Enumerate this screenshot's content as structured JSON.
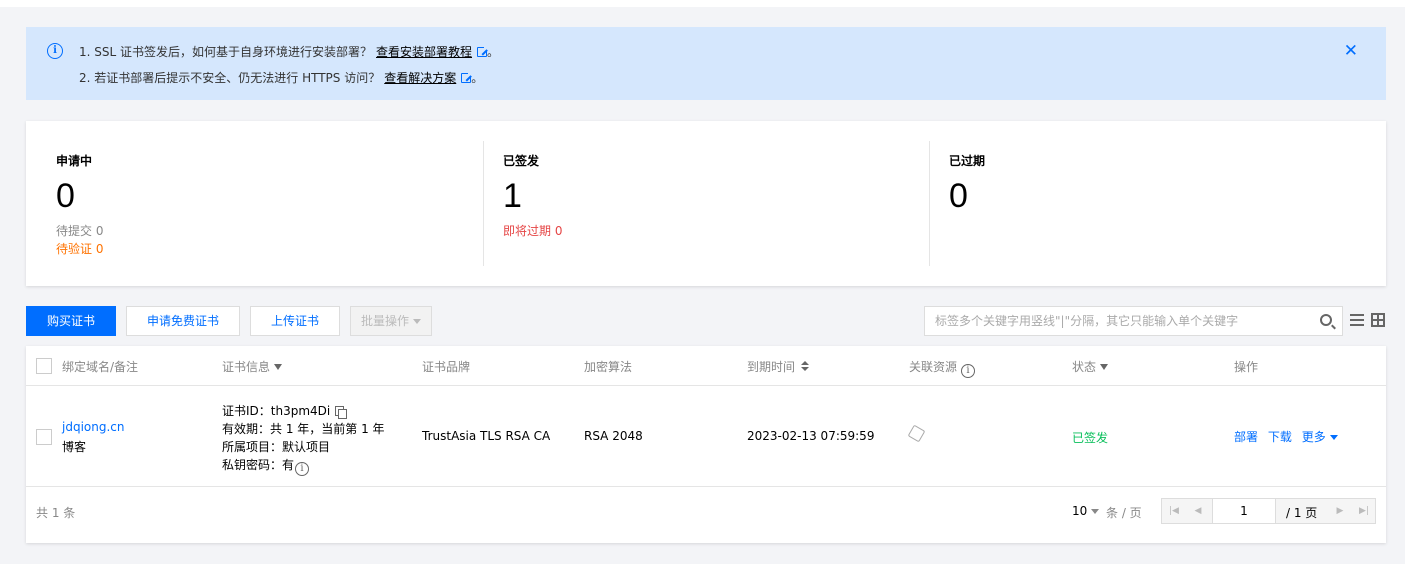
{
  "notice": {
    "line1_text": "1. SSL 证书签发后，如何基于自身环境进行安装部署？",
    "line1_link": "查看安装部署教程",
    "line2_text": "2. 若证书部署后提示不安全、仍无法进行 HTTPS 访问？",
    "line2_link": "查看解决方案",
    "period": "。",
    "close": "✕"
  },
  "stats": {
    "applying": {
      "label": "申请中",
      "count": "0",
      "pending_submit": "待提交 0",
      "pending_verify": "待验证 0"
    },
    "issued": {
      "label": "已签发",
      "count": "1",
      "expiring": "即将过期 0"
    },
    "expired": {
      "label": "已过期",
      "count": "0"
    }
  },
  "toolbar": {
    "buy": "购买证书",
    "apply_free": "申请免费证书",
    "upload": "上传证书",
    "batch": "批量操作",
    "search_placeholder": "标签多个关键字用竖线\"|\"分隔，其它只能输入单个关键字"
  },
  "table": {
    "headers": {
      "domain": "绑定域名/备注",
      "cert_info": "证书信息",
      "brand": "证书品牌",
      "algorithm": "加密算法",
      "expiry": "到期时间",
      "resources": "关联资源",
      "status": "状态",
      "actions": "操作"
    },
    "rows": [
      {
        "domain": "jdqiong.cn",
        "note": "博客",
        "cert_id": "证书ID：th3pm4Di",
        "validity": "有效期：共 1 年，当前第 1 年",
        "project": "所属项目：默认项目",
        "private_key": "私钥密码：有",
        "brand": "TrustAsia TLS RSA CA",
        "algorithm": "RSA 2048",
        "expiry": "2023-02-13 07:59:59",
        "status": "已签发",
        "action_deploy": "部署",
        "action_download": "下载",
        "action_more": "更多"
      }
    ],
    "footer": {
      "total": "共 1 条",
      "page_size": "10",
      "per_page": "条 / 页",
      "current_page": "1",
      "total_pages": "/ 1 页"
    }
  },
  "colors": {
    "primary": "#006eff",
    "success": "#0abf5b",
    "warning": "#ff7200",
    "danger": "#e54545",
    "notice_bg": "#d5e7fd"
  }
}
